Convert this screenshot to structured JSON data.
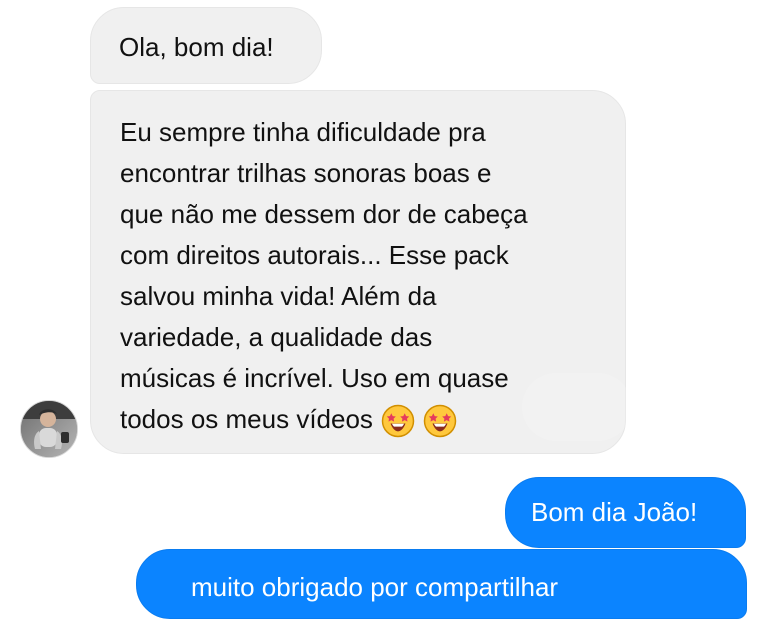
{
  "chat": {
    "incoming_messages": [
      {
        "text": "Ola, bom dia!"
      },
      {
        "lines": [
          "Eu sempre tinha dificuldade pra",
          "encontrar trilhas sonoras boas e",
          "que não me dessem dor de cabeça",
          "com direitos autorais... Esse pack",
          "salvou minha vida! Além da",
          "variedade, a qualidade das",
          "músicas é incrível. Uso em quase",
          "todos os meus vídeos"
        ],
        "emoji": [
          "star-struck-emoji",
          "star-struck-emoji"
        ]
      }
    ],
    "outgoing_messages": [
      {
        "text": "Bom dia João!"
      },
      {
        "text": "muito obrigado por compartilhar"
      }
    ],
    "avatar": {
      "icon": "user-avatar"
    },
    "colors": {
      "incoming_bubble": "#f0f0f0",
      "outgoing_bubble": "#0b84ff",
      "text": "#111111"
    }
  }
}
